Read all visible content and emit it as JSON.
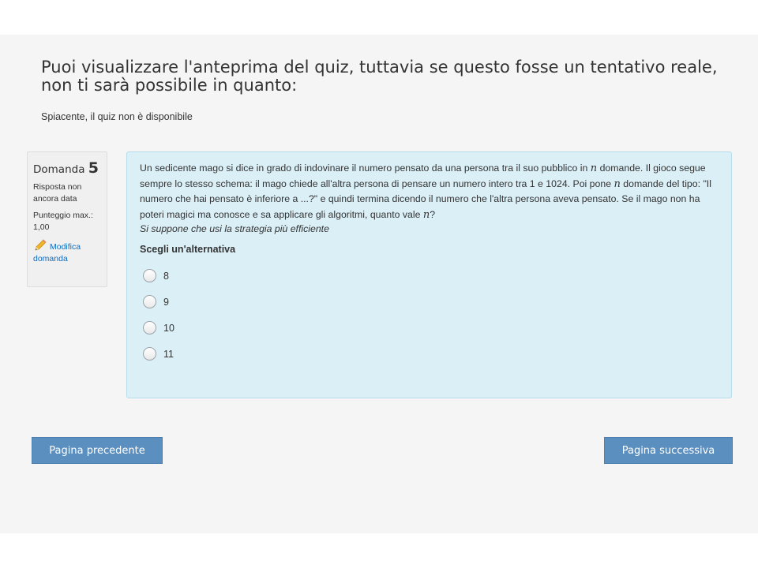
{
  "preview": {
    "heading": "Puoi visualizzare l'anteprima del quiz, tuttavia se questo fosse un tentativo reale, non ti sarà possibile in quanto:",
    "unavailable": "Spiacente, il quiz non è disponibile"
  },
  "question": {
    "label": "Domanda",
    "number": "5",
    "status": "Risposta non ancora data",
    "score": "Punteggio max.: 1,00",
    "edit_link": "Modifica domanda",
    "text_1": "Un sedicente mago si dice in grado di indovinare il numero pensato da una persona tra il suo pubblico in ",
    "var": "n",
    "text_2": " domande. Il gioco segue sempre lo stesso schema: il mago chiede all'altra persona di pensare un numero intero tra 1 e 1024. Poi pone ",
    "text_3": " domande del tipo: \"Il numero che hai pensato è inferiore a ...?\" e quindi termina dicendo il numero che l'altra persona aveva pensato. Se il mago non ha poteri magici ma conosce e sa applicare gli algoritmi, quanto vale ",
    "text_4": "?",
    "hint": "Si suppone che usi la strategia più efficiente",
    "prompt": "Scegli un'alternativa",
    "options": [
      "8",
      "9",
      "10",
      "11"
    ],
    "selected": null
  },
  "navigation": {
    "prev": "Pagina precedente",
    "next": "Pagina successiva"
  },
  "colors": {
    "content_bg": "#dbeff7",
    "button_bg": "#5b8fbf",
    "link": "#0f6cbf"
  },
  "icons": {
    "edit": "pencil-icon"
  }
}
